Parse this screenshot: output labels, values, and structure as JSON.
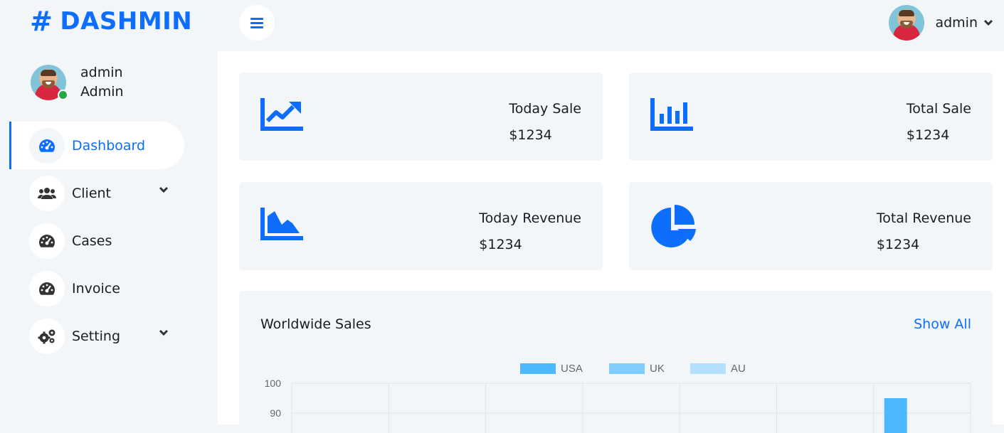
{
  "brand": {
    "name": "DASHMIN",
    "symbol": "#",
    "color": "#0d6efd"
  },
  "sidebar": {
    "user": {
      "name": "admin",
      "role": "Admin",
      "status": "online"
    },
    "items": [
      {
        "label": "Dashboard",
        "icon": "tachometer-icon",
        "active": true
      },
      {
        "label": "Client",
        "icon": "users-icon",
        "has_submenu": true
      },
      {
        "label": "Cases",
        "icon": "tachometer-icon"
      },
      {
        "label": "Invoice",
        "icon": "tachometer-icon"
      },
      {
        "label": "Setting",
        "icon": "cogs-icon",
        "has_submenu": true
      }
    ]
  },
  "topbar": {
    "menu_icon": "bars-icon",
    "user_name": "admin",
    "dropdown_icon": "chevron-down-icon"
  },
  "cards": [
    {
      "label": "Today Sale",
      "value": "$1234",
      "icon": "chart-line-icon"
    },
    {
      "label": "Total Sale",
      "value": "$1234",
      "icon": "chart-bar-icon"
    },
    {
      "label": "Today Revenue",
      "value": "$1234",
      "icon": "chart-area-icon"
    },
    {
      "label": "Total Revenue",
      "value": "$1234",
      "icon": "chart-pie-icon"
    }
  ],
  "sales": {
    "title": "Worldwide Sales",
    "show_all": "Show All"
  },
  "chart_data": {
    "type": "bar",
    "series": [
      {
        "name": "USA",
        "color": "#4db8ff",
        "values": [
          null,
          null,
          null,
          null,
          null,
          null,
          95
        ]
      },
      {
        "name": "UK",
        "color": "#80ccff",
        "values": [
          null,
          null,
          null,
          null,
          null,
          null,
          null
        ]
      },
      {
        "name": "AU",
        "color": "#b3e0ff",
        "values": [
          null,
          null,
          null,
          null,
          null,
          null,
          null
        ]
      }
    ],
    "y_ticks": [
      100,
      90
    ],
    "ylim": [
      0,
      100
    ],
    "grid": true,
    "legend_position": "top"
  }
}
